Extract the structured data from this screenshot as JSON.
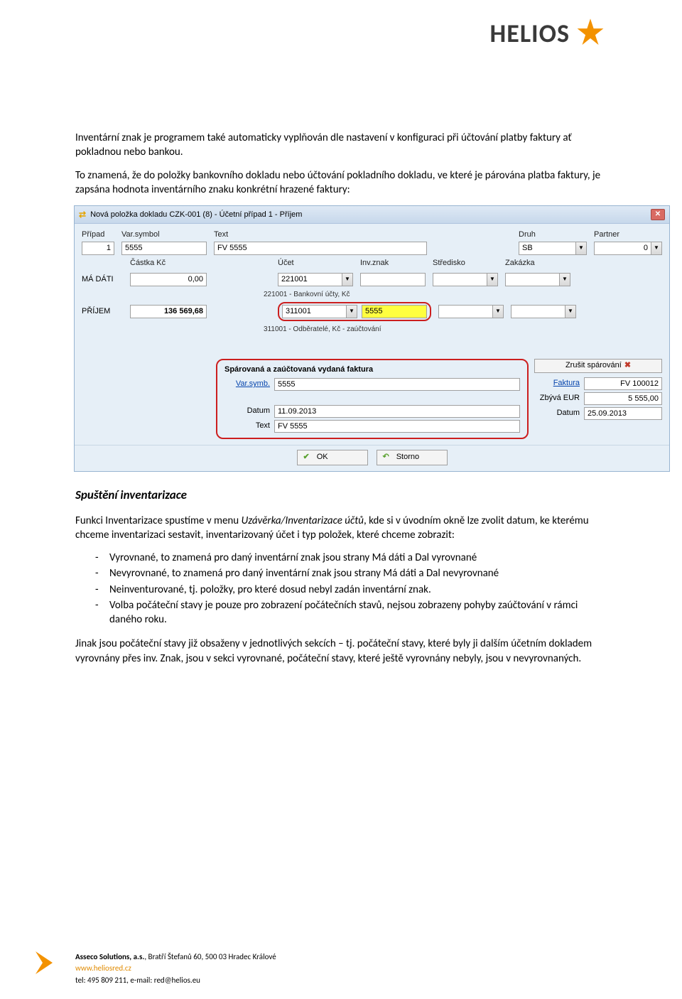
{
  "logo": {
    "text": "HELIOS"
  },
  "paragraphs": {
    "p1": "Inventární znak je programem také automaticky vyplňován dle nastavení v konfiguraci při účtování platby faktury ať pokladnou nebo bankou.",
    "p2": "To znamená, že do položky bankovního dokladu nebo účtování pokladního dokladu, ve které je párována platba faktury, je zapsána hodnota inventárního znaku konkrétní hrazené faktury:",
    "h3": "Spuštění inventarizace",
    "p3_a": "Funkci Inventarizace spustíme v  menu ",
    "p3_i": "Uzávěrka/Inventarizace účtů",
    "p3_b": ", kde si v úvodním okně lze zvolit datum, ke kterému chceme inventarizaci sestavit, inventarizovaný účet i typ položek, které chceme zobrazit:",
    "b1": "Vyrovnané, to znamená  pro daný inventární znak jsou strany Má dáti a Dal vyrovnané",
    "b2": "Nevyrovnané, to znamená pro daný inventární znak jsou strany Má dáti a Dal nevyrovnané",
    "b3": "Neinventurované, tj. položky, pro které dosud nebyl zadán inventární znak.",
    "b4": "Volba počáteční stavy je pouze pro zobrazení počátečních stavů, nejsou zobrazeny pohyby zaúčtování v rámci daného roku.",
    "p4": "Jinak jsou počáteční stavy již obsaženy v jednotlivých sekcích – tj. počáteční stavy, které byly ji dalším účetním dokladem vyrovnány přes inv. Znak, jsou v sekci vyrovnané, počáteční stavy, které ještě vyrovnány nebyly, jsou v nevyrovnaných."
  },
  "window": {
    "title": "Nová položka dokladu CZK-001 (8) - Účetní případ 1 - Příjem",
    "labels": {
      "pripad": "Případ",
      "varsymbol": "Var.symbol",
      "text": "Text",
      "druh": "Druh",
      "partner": "Partner",
      "castka": "Částka Kč",
      "ucet": "Účet",
      "invznak": "Inv.znak",
      "stredisko": "Středisko",
      "zakazka": "Zakázka",
      "madati": "MÁ DÁTI",
      "prijem": "PŘÍJEM"
    },
    "row1": {
      "pripad": "1",
      "varsymbol": "5555",
      "text": "FV 5555",
      "druh": "SB",
      "partner": "0"
    },
    "row_madati": {
      "castka": "0,00",
      "ucet": "221001",
      "ucet_note": "221001 - Bankovní účty, Kč"
    },
    "row_prijem": {
      "castka": "136 569,68",
      "ucet": "311001",
      "invznak": "5555",
      "ucet_note": "311001 - Odběratelé, Kč - zaúčtování"
    },
    "paired": {
      "header": "Spárovaná a zaúčtovaná vydaná faktura",
      "varsymb_label": "Var.symb.",
      "varsymb": "5555",
      "faktura_label": "Faktura",
      "faktura": "FV 100012",
      "zbyva_label": "Zbývá EUR",
      "zbyva": "5 555,00",
      "datum_label": "Datum",
      "datum1": "11.09.2013",
      "datum2": "25.09.2013",
      "text_label": "Text",
      "text": "FV 5555",
      "unpair": "Zrušit spárování"
    },
    "buttons": {
      "ok": "OK",
      "storno": "Storno"
    }
  },
  "footer": {
    "company": "Asseco Solutions, a.s.",
    "address": ", Bratří Štefanů 60, 500 03 Hradec Králové",
    "url": "www.heliosred.cz",
    "contact": "tel: 495 809 211, e-mail: red@helios.eu"
  }
}
